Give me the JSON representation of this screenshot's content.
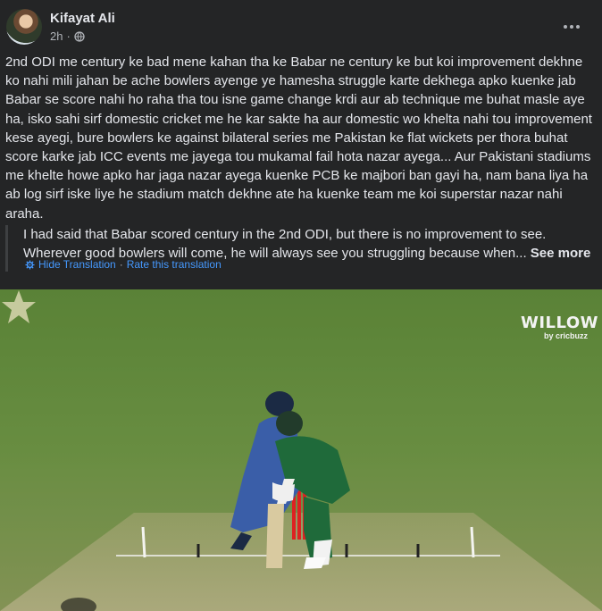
{
  "post": {
    "author": "Kifayat Ali",
    "time": "2h",
    "dot": "·",
    "text": "2nd ODI me century ke bad mene kahan tha ke Babar ne century ke but koi improvement dekhne ko nahi mili jahan be ache bowlers ayenge ye hamesha struggle karte dekhega apko kuenke jab Babar se score nahi ho raha tha tou isne game change krdi aur ab technique me buhat masle aye ha, isko sahi sirf domestic cricket me he kar sakte ha aur domestic wo khelta nahi tou improvement kese ayegi, bure bowlers ke against bilateral series me Pakistan ke flat wickets per thora buhat score karke jab ICC events me jayega tou mukamal fail hota nazar ayega... Aur Pakistani stadiums me khelte howe apko har jaga nazar ayega kuenke PCB ke majbori ban gayi ha, nam bana liya ha ab log sirf iske liye he stadium match dekhne ate ha kuenke team me koi superstar nazar nahi araha."
  },
  "translation": {
    "text": "I had said that Babar scored century in the 2nd ODI, but there is no improvement to see. Wherever good bowlers will come, he will always see you struggling because when...",
    "see_more": "See more",
    "hide_label": "Hide Translation",
    "separator": "·",
    "rate_label": "Rate this translation"
  },
  "video": {
    "watermark": "WILLOW",
    "watermark_sub": "by cricbuzz"
  },
  "icons": {
    "more": "more-horizontal-icon",
    "privacy": "globe-icon",
    "translation": "gear-icon",
    "broadcaster": "pcb-star-logo"
  },
  "colors": {
    "background": "#242526",
    "text": "#e4e6eb",
    "secondary_text": "#b0b3b8",
    "link": "#4599ff",
    "pitch_green": "#6a8a3c",
    "jersey_green": "#1f6a3a"
  }
}
